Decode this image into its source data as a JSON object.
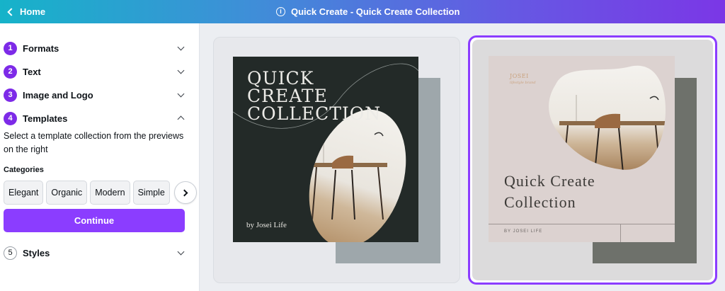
{
  "header": {
    "home_label": "Home",
    "title": "Quick Create - Quick Create Collection"
  },
  "sidebar": {
    "steps": [
      {
        "number": "1",
        "label": "Formats",
        "expanded": false
      },
      {
        "number": "2",
        "label": "Text",
        "expanded": false
      },
      {
        "number": "3",
        "label": "Image and Logo",
        "expanded": false
      },
      {
        "number": "4",
        "label": "Templates",
        "expanded": true
      },
      {
        "number": "5",
        "label": "Styles",
        "expanded": false
      }
    ],
    "description": "Select a template collection from the previews on the right",
    "categories_label": "Categories",
    "categories": [
      "Elegant",
      "Organic",
      "Modern",
      "Simple"
    ],
    "continue_label": "Continue"
  },
  "previews": [
    {
      "title_lines": [
        "QUICK",
        "CREATE",
        "COLLECTION"
      ],
      "byline": "by Josei Life",
      "selected": false
    },
    {
      "brand": "JOSEI",
      "brand_tagline": "lifestyle brand",
      "title_lines": [
        "Quick Create",
        "Collection"
      ],
      "byline": "BY JOSEI LIFE",
      "selected": true
    }
  ],
  "colors": {
    "accent": "#8b3dff",
    "badge": "#7d2ae8",
    "template1_bg": "#232a28",
    "template2_bg": "#dcd2d0"
  }
}
